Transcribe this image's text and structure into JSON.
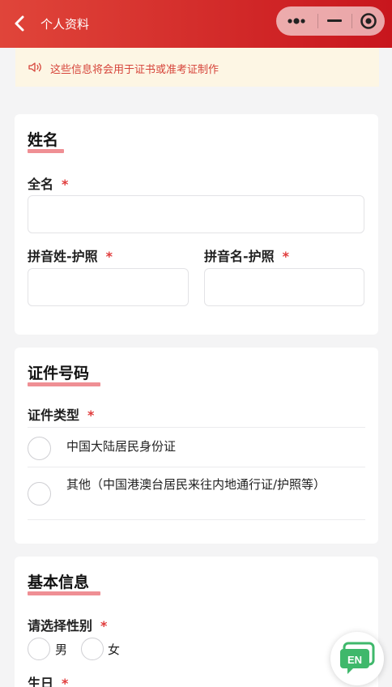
{
  "header": {
    "title": "个人资料"
  },
  "notice": {
    "text": "这些信息将会用于证书或准考证制作"
  },
  "name_section": {
    "title": "姓名",
    "full_name_label": "全名",
    "surname_label": "拼音姓-护照",
    "given_name_label": "拼音名-护照",
    "required_mark": "*"
  },
  "id_section": {
    "title": "证件号码",
    "type_label": "证件类型",
    "required_mark": "*",
    "options": [
      "中国大陆居民身份证",
      "其他（中国港澳台居民来往内地通行证/护照等）"
    ]
  },
  "basic_section": {
    "title": "基本信息",
    "gender_label": "请选择性别",
    "required_mark": "*",
    "gender_options": [
      "男",
      "女"
    ],
    "birthday_label": "生日"
  },
  "chat_button": {
    "text": "EN"
  },
  "colors": {
    "header_start": "#e0453a",
    "header_end": "#c8161d",
    "accent": "#ef8f94",
    "required": "#e03b3b",
    "chat_green": "#3fb86b"
  }
}
